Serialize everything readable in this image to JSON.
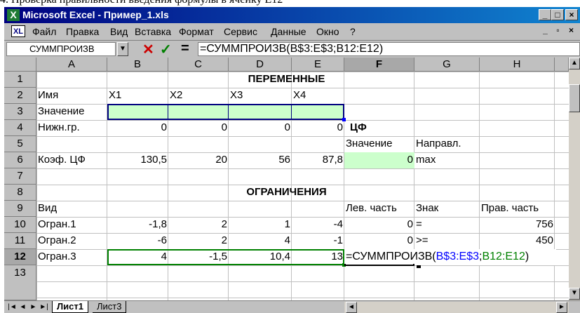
{
  "caption": "4. Проверка правильности введения формулы в ячейку Е12",
  "window": {
    "app_title": "Microsoft Excel - Пример_1.xls",
    "app_icon": "excel-icon",
    "buttons": {
      "minimize": "_",
      "maximize": "□",
      "close": "×"
    }
  },
  "menu": {
    "doc_icon": "document-icon",
    "items": [
      {
        "label": "Файл"
      },
      {
        "label": "Правка"
      },
      {
        "label": "Вид"
      },
      {
        "label": "Вставка"
      },
      {
        "label": "Формат"
      },
      {
        "label": "Сервис"
      },
      {
        "label": "Данные"
      },
      {
        "label": "Окно"
      },
      {
        "label": "?"
      }
    ],
    "doc_buttons": {
      "minimize": "_",
      "restore": "▫",
      "close": "×"
    }
  },
  "formula_bar": {
    "name_box": "СУММПРОИЗВ",
    "cancel": "✕",
    "enter": "✓",
    "equals": "=",
    "formula": "=СУММПРОИЗВ(B$3:E$3;B12:E12)"
  },
  "columns": [
    "A",
    "B",
    "C",
    "D",
    "E",
    "F",
    "G",
    "H"
  ],
  "rows": [
    "1",
    "2",
    "3",
    "4",
    "5",
    "6",
    "7",
    "8",
    "9",
    "10",
    "11",
    "12",
    "13"
  ],
  "cells": {
    "D1": "ПЕРЕМЕННЫЕ",
    "A2": "Имя",
    "B2": "X1",
    "C2": "X2",
    "D2": "X3",
    "E2": "X4",
    "A3": "Значение",
    "A4": "Нижн.гр.",
    "B4": "0",
    "C4": "0",
    "D4": "0",
    "E4": "0",
    "F4": "ЦФ",
    "F5": "Значение",
    "G5": "Направл.",
    "A6": "Коэф. ЦФ",
    "B6": "130,5",
    "C6": "20",
    "D6": "56",
    "E6": "87,8",
    "F6": "0",
    "G6": "max",
    "D8": "ОГРАНИЧЕНИЯ",
    "A9": "Вид",
    "F9": "Лев. часть",
    "G9": "Знак",
    "H9": "Прав. часть",
    "A10": "Огран.1",
    "B10": "-1,8",
    "C10": "2",
    "D10": "1",
    "E10": "-4",
    "F10": "0",
    "G10": "=",
    "H10": "756",
    "A11": "Огран.2",
    "B11": "-6",
    "C11": "2",
    "D11": "4",
    "E11": "-1",
    "F11": "0",
    "G11": ">=",
    "H11": "450",
    "A12": "Огран.3",
    "B12": "4",
    "C12": "-1,5",
    "D12": "10,4",
    "E12": "13"
  },
  "edit_formula": {
    "prefix": "=СУММПРОИЗВ(",
    "ref1": "B$3:E$3",
    "sep": ";",
    "ref2": "B12:E12",
    "suffix": ")"
  },
  "colors": {
    "highlight_fill": "#ccffcc",
    "ref1_color": "#0000ff",
    "ref2_color": "#008000",
    "title_bar": "#000080"
  },
  "sheet_tabs": [
    {
      "label": "Лист1",
      "active": true
    },
    {
      "label": "Лист3",
      "active": false
    }
  ],
  "scroll": {
    "up": "▲",
    "down": "▼",
    "left": "◄",
    "right": "►"
  },
  "tab_nav": [
    "|◄",
    "◄",
    "►",
    "►|"
  ]
}
